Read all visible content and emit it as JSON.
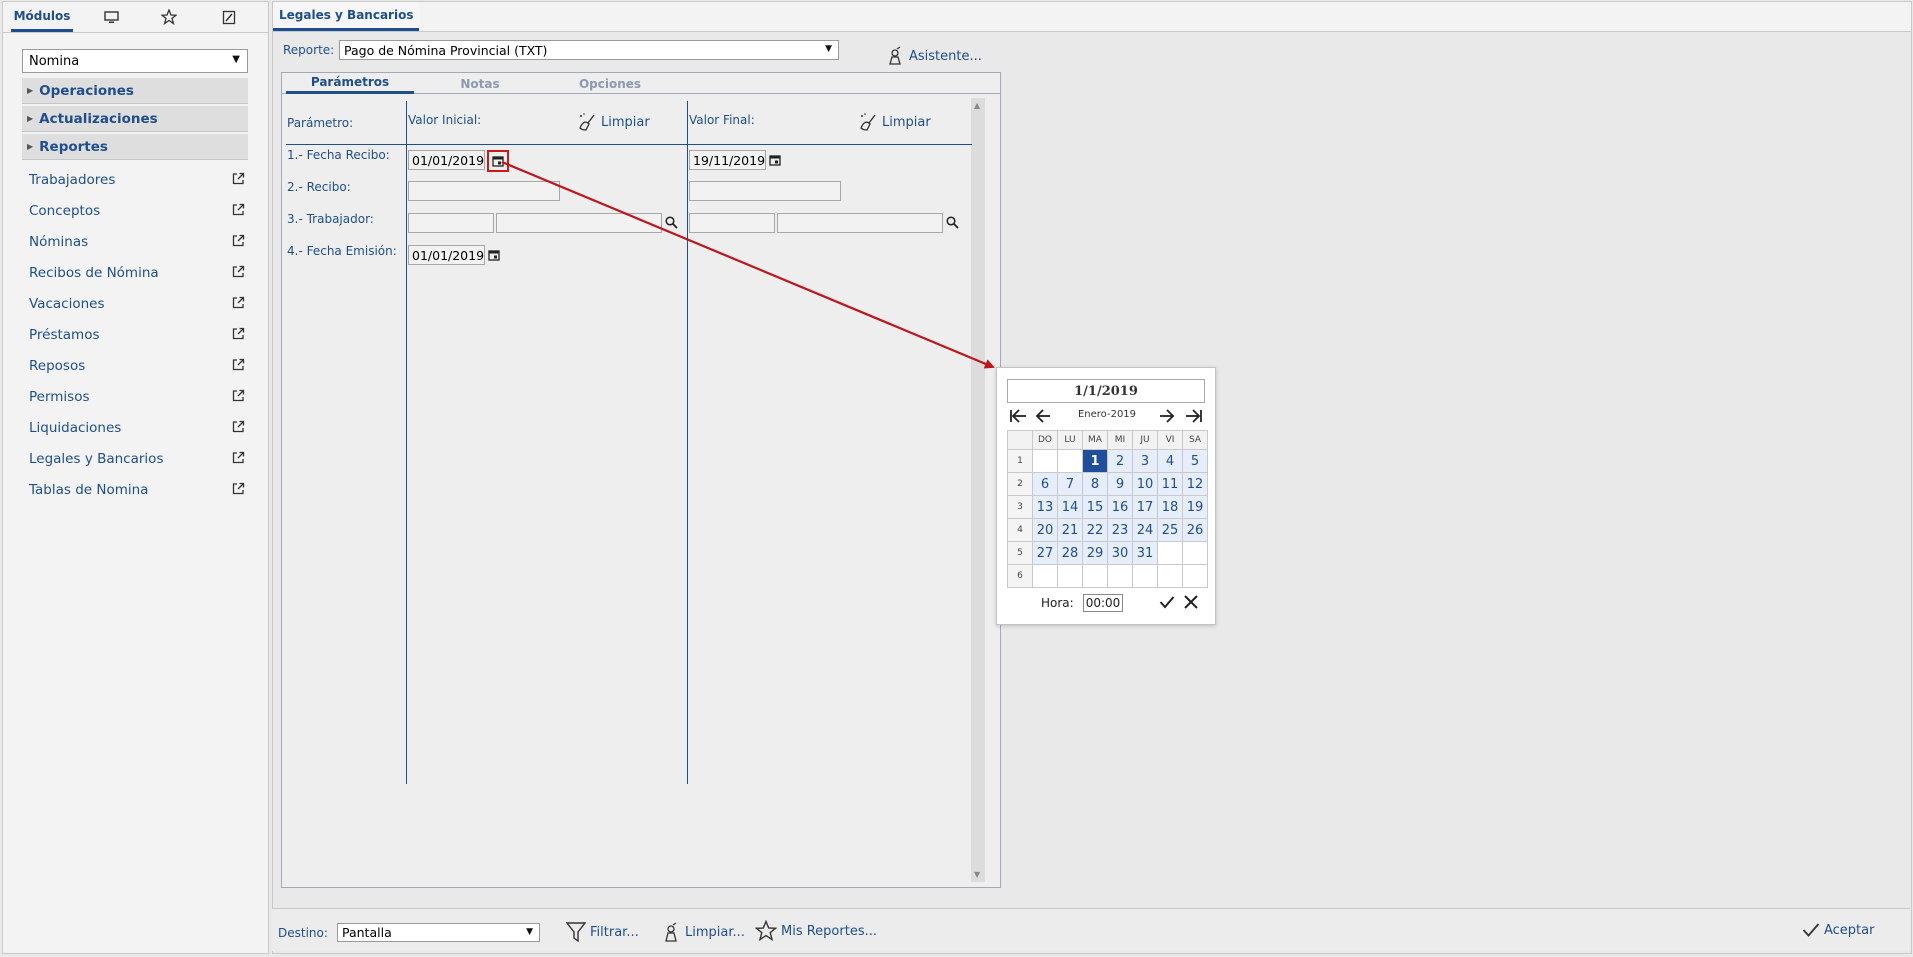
{
  "sidebar": {
    "tab_modules": "Módulos",
    "module_select": "Nomina",
    "groups": [
      "Operaciones",
      "Actualizaciones",
      "Reportes"
    ],
    "items": [
      "Trabajadores",
      "Conceptos",
      "Nóminas",
      "Recibos de Nómina",
      "Vacaciones",
      "Préstamos",
      "Reposos",
      "Permisos",
      "Liquidaciones",
      "Legales y Bancarios",
      "Tablas de Nomina"
    ]
  },
  "main": {
    "tab_title": "Legales y Bancarios",
    "report_label": "Reporte:",
    "report_value": "Pago de Nómina Provincial (TXT)",
    "wizard_label": "Asistente...",
    "panel_tabs": [
      "Parámetros",
      "Notas",
      "Opciones"
    ],
    "param_header": "Parámetro:",
    "initial_header": "Valor Inicial:",
    "final_header": "Valor Final:",
    "clear_label": "Limpiar",
    "params": [
      {
        "label": "1.- Fecha Recibo:",
        "initial": "01/01/2019",
        "final": "19/11/2019"
      },
      {
        "label": "2.- Recibo:",
        "initial": "",
        "final": ""
      },
      {
        "label": "3.- Trabajador:",
        "initial": "",
        "final": ""
      },
      {
        "label": "4.- Fecha Emisión:",
        "initial": "01/01/2019",
        "final": ""
      }
    ]
  },
  "calendar": {
    "date": "1/1/2019",
    "month": "Enero-2019",
    "weekdays": [
      "DO",
      "LU",
      "MA",
      "MI",
      "JU",
      "VI",
      "SA"
    ],
    "weeks": [
      [
        "1",
        "",
        "",
        "1",
        "2",
        "3",
        "4",
        "5"
      ],
      [
        "2",
        "6",
        "7",
        "8",
        "9",
        "10",
        "11",
        "12"
      ],
      [
        "3",
        "13",
        "14",
        "15",
        "16",
        "17",
        "18",
        "19"
      ],
      [
        "4",
        "20",
        "21",
        "22",
        "23",
        "24",
        "25",
        "26"
      ],
      [
        "5",
        "27",
        "28",
        "29",
        "30",
        "31",
        "",
        ""
      ],
      [
        "6",
        "",
        "",
        "",
        "",
        "",
        "",
        ""
      ]
    ],
    "selected_day": "1",
    "hora_label": "Hora:",
    "hora_value": "00:00"
  },
  "bottom": {
    "destino_label": "Destino:",
    "destino_value": "Pantalla",
    "filter_label": "Filtrar...",
    "clear_label": "Limpiar...",
    "myreports_label": "Mis Reportes...",
    "accept_label": "Aceptar"
  },
  "colors": {
    "accent": "#1f4e8f",
    "selected_day": "#1f4e9a",
    "annotation_arrow": "#c0161b"
  }
}
